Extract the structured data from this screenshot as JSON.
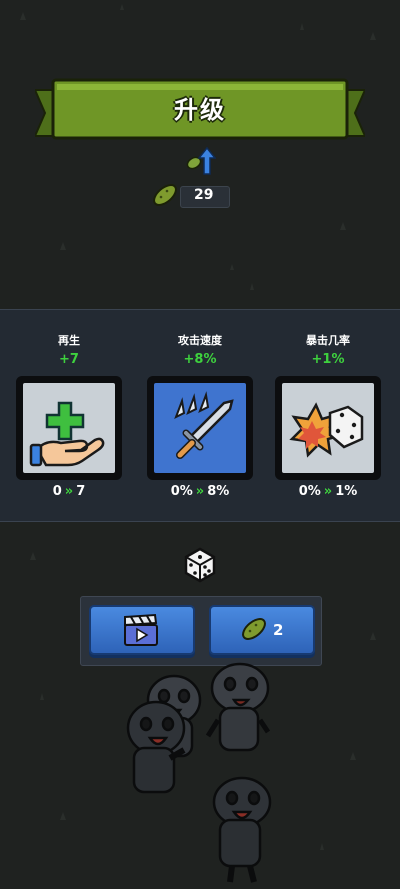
{
  "header": {
    "title": "升级"
  },
  "currency": {
    "icon": "pickle-icon",
    "amount": "29"
  },
  "upgrades": [
    {
      "name": "再生",
      "bonus": "+7",
      "from": "0",
      "to": "7",
      "arrow": "»",
      "icon": "heal-hand-icon"
    },
    {
      "name": "攻击速度",
      "bonus": "+8%",
      "from": "0%",
      "to": "8%",
      "arrow": "»",
      "icon": "speed-sword-icon"
    },
    {
      "name": "暴击几率",
      "bonus": "+1%",
      "from": "0%",
      "to": "1%",
      "arrow": "»",
      "icon": "crit-dice-icon"
    }
  ],
  "reroll": {
    "icon": "dice-icon",
    "video_button_icon": "video-clapper-icon",
    "pickle_button_icon": "pickle-icon",
    "pickle_cost": "2"
  },
  "colors": {
    "background": "#1f2220",
    "banner_green": "#6f9626",
    "bonus_green": "#3ed13e",
    "button_blue": "#3b79d4",
    "panel": "#232a33"
  }
}
